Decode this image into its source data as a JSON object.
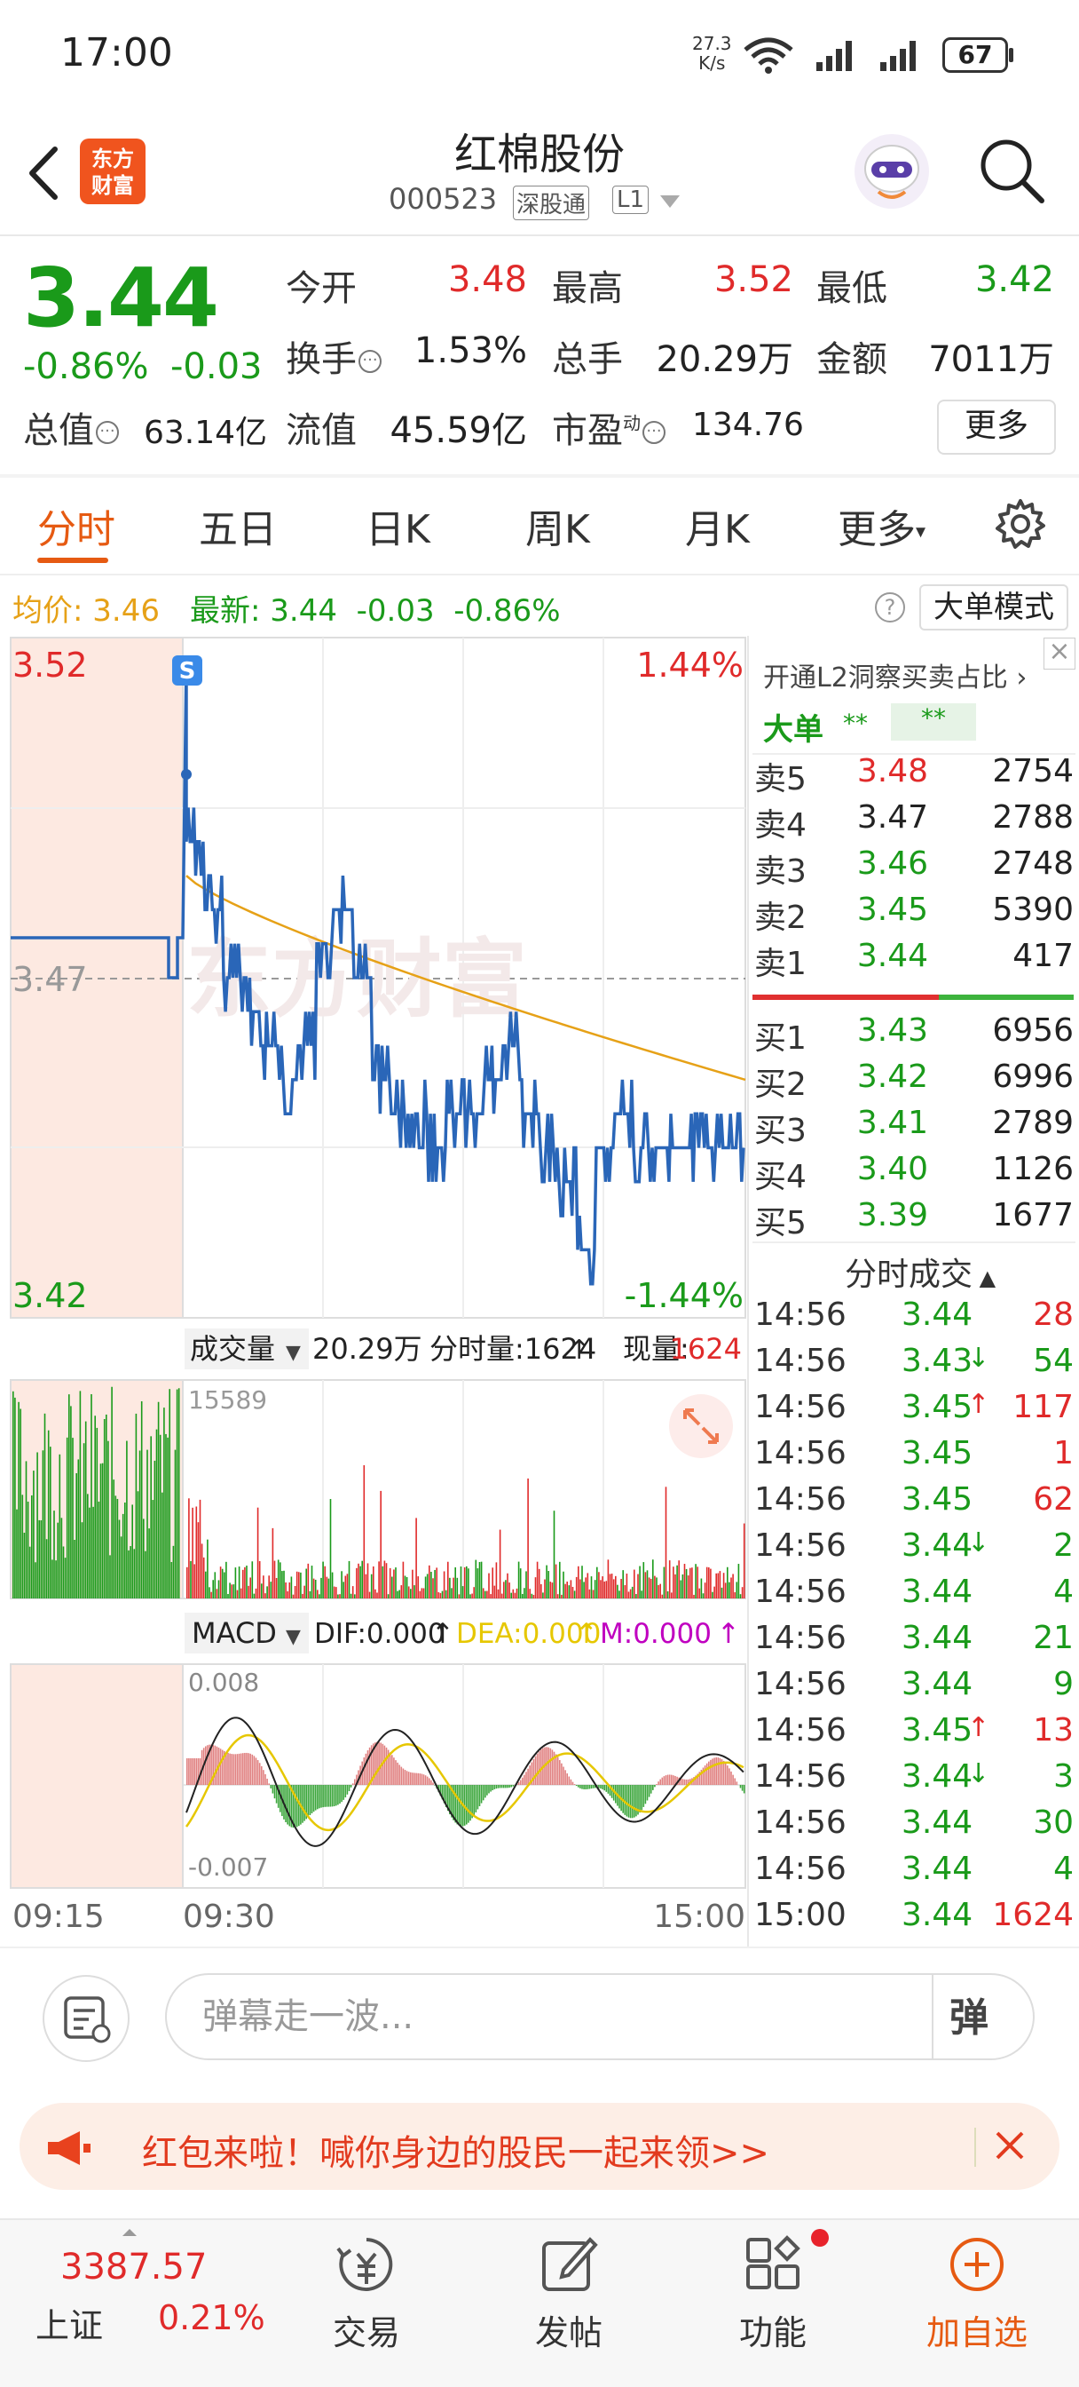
{
  "status_bar": {
    "time": "17:00",
    "net_speed_value": "27.3",
    "net_speed_unit": "K/s",
    "battery": "67"
  },
  "header": {
    "logo_line1": "东方",
    "logo_line2": "财富",
    "stock_name": "红棉股份",
    "stock_code": "000523",
    "exchange_tag": "深股通",
    "level_tag": "L1"
  },
  "quote": {
    "price": "3.44",
    "change_pct": "-0.86%",
    "change": "-0.03",
    "open_label": "今开",
    "open": "3.48",
    "high_label": "最高",
    "high": "3.52",
    "low_label": "最低",
    "low": "3.42",
    "turnover_label": "换手",
    "turnover": "1.53%",
    "volume_label": "总手",
    "volume": "20.29万",
    "amount_label": "金额",
    "amount": "7011万",
    "market_cap_label": "总值",
    "market_cap": "63.14亿",
    "float_cap_label": "流值",
    "float_cap": "45.59亿",
    "pe_label": "市盈",
    "pe_sup": "动",
    "pe": "134.76",
    "more_button": "更多"
  },
  "tabs": [
    {
      "label": "分时",
      "active": true
    },
    {
      "label": "五日"
    },
    {
      "label": "日K"
    },
    {
      "label": "周K"
    },
    {
      "label": "月K"
    },
    {
      "label": "更多"
    }
  ],
  "info_bar": {
    "avg_label": "均价:",
    "avg_value": "3.46",
    "latest_label": "最新:",
    "latest_price": "3.44",
    "latest_change": "-0.03",
    "latest_pct": "-0.86%",
    "big_order_button": "大单模式"
  },
  "chart": {
    "y_max": "3.52",
    "y_ref": "3.47",
    "y_min": "3.42",
    "pct_max": "1.44%",
    "pct_min": "-1.44%",
    "marker": "S",
    "watermark": "东方财富",
    "volume_selector": "成交量",
    "volume_total": "20.29万",
    "volume_minute": "分时量:1624",
    "volume_now_label": "现量:",
    "volume_now": "1624",
    "volume_axis_max": "15589",
    "macd_selector": "MACD",
    "dif": "DIF:0.000",
    "dea": "DEA:0.000",
    "macd_m": "M:0.000",
    "macd_max": "0.008",
    "macd_min": "-0.007",
    "time_start": "09:15",
    "time_open": "09:30",
    "time_end": "15:00",
    "colors": {
      "price_line": "#2a66b8",
      "avg_line": "#e6a117",
      "up": "#e02a2a",
      "down": "#1a9a1a",
      "dea": "#e6c700",
      "m": "#c000c0"
    }
  },
  "order_book": {
    "banner": "开通L2洞察买卖占比",
    "big_order_label": "大单",
    "big_order_val1": "**",
    "big_order_val2": "**",
    "asks": [
      {
        "label": "卖5",
        "price": "3.48",
        "volume": "2754",
        "color": "red"
      },
      {
        "label": "卖4",
        "price": "3.47",
        "volume": "2788",
        "color": "black"
      },
      {
        "label": "卖3",
        "price": "3.46",
        "volume": "2748",
        "color": "green"
      },
      {
        "label": "卖2",
        "price": "3.45",
        "volume": "5390",
        "color": "green"
      },
      {
        "label": "卖1",
        "price": "3.44",
        "volume": "417",
        "color": "green"
      }
    ],
    "bids": [
      {
        "label": "买1",
        "price": "3.43",
        "volume": "6956",
        "color": "green"
      },
      {
        "label": "买2",
        "price": "3.42",
        "volume": "6996",
        "color": "green"
      },
      {
        "label": "买3",
        "price": "3.41",
        "volume": "2789",
        "color": "green"
      },
      {
        "label": "买4",
        "price": "3.40",
        "volume": "1126",
        "color": "green"
      },
      {
        "label": "买5",
        "price": "3.39",
        "volume": "1677",
        "color": "green"
      }
    ]
  },
  "trades": {
    "title": "分时成交",
    "rows": [
      {
        "time": "14:56",
        "price": "3.44",
        "arrow": "",
        "volume": "28",
        "pcolor": "green",
        "vcolor": "red"
      },
      {
        "time": "14:56",
        "price": "3.43",
        "arrow": "↓",
        "volume": "54",
        "pcolor": "green",
        "vcolor": "green"
      },
      {
        "time": "14:56",
        "price": "3.45",
        "arrow": "↑",
        "volume": "117",
        "pcolor": "green",
        "vcolor": "red"
      },
      {
        "time": "14:56",
        "price": "3.45",
        "arrow": "",
        "volume": "1",
        "pcolor": "green",
        "vcolor": "red"
      },
      {
        "time": "14:56",
        "price": "3.45",
        "arrow": "",
        "volume": "62",
        "pcolor": "green",
        "vcolor": "red"
      },
      {
        "time": "14:56",
        "price": "3.44",
        "arrow": "↓",
        "volume": "2",
        "pcolor": "green",
        "vcolor": "green"
      },
      {
        "time": "14:56",
        "price": "3.44",
        "arrow": "",
        "volume": "4",
        "pcolor": "green",
        "vcolor": "green"
      },
      {
        "time": "14:56",
        "price": "3.44",
        "arrow": "",
        "volume": "21",
        "pcolor": "green",
        "vcolor": "green"
      },
      {
        "time": "14:56",
        "price": "3.44",
        "arrow": "",
        "volume": "9",
        "pcolor": "green",
        "vcolor": "green"
      },
      {
        "time": "14:56",
        "price": "3.45",
        "arrow": "↑",
        "volume": "13",
        "pcolor": "green",
        "vcolor": "red"
      },
      {
        "time": "14:56",
        "price": "3.44",
        "arrow": "↓",
        "volume": "3",
        "pcolor": "green",
        "vcolor": "green"
      },
      {
        "time": "14:56",
        "price": "3.44",
        "arrow": "",
        "volume": "30",
        "pcolor": "green",
        "vcolor": "green"
      },
      {
        "time": "14:56",
        "price": "3.44",
        "arrow": "",
        "volume": "4",
        "pcolor": "green",
        "vcolor": "green"
      },
      {
        "time": "15:00",
        "price": "3.44",
        "arrow": "",
        "volume": "1624",
        "pcolor": "green",
        "vcolor": "red"
      }
    ]
  },
  "danmu": {
    "placeholder": "弹幕走一波...",
    "button": "弹"
  },
  "promo": {
    "text": "红包来啦！喊你身边的股民一起来领>>"
  },
  "bottom_nav": {
    "index_value": "3387.57",
    "index_name": "上证",
    "index_pct": "0.21%",
    "items": [
      {
        "label": "交易"
      },
      {
        "label": "发帖"
      },
      {
        "label": "功能"
      },
      {
        "label": "加自选"
      }
    ]
  }
}
